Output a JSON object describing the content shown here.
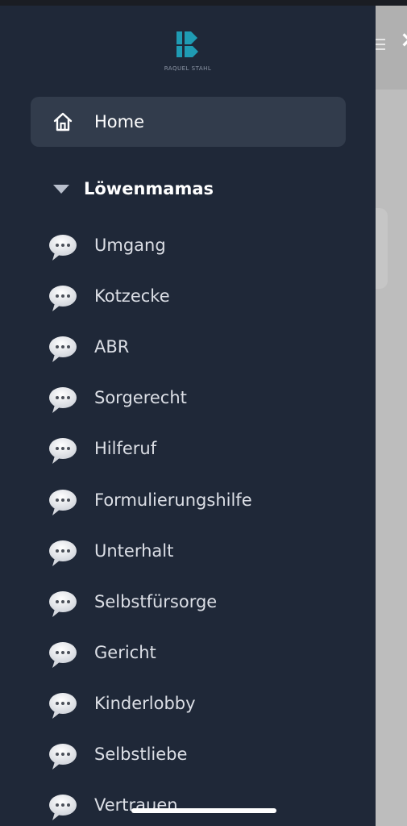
{
  "logo": {
    "text": "RAQUEL STAHL",
    "accent_color": "#1f9bb3"
  },
  "nav": {
    "home": {
      "label": "Home",
      "icon": "home-icon"
    },
    "group": {
      "label": "Löwenmamas",
      "icon": "caret-down-icon"
    },
    "channels": [
      {
        "label": "Umgang",
        "icon": "speech-bubble-icon"
      },
      {
        "label": "Kotzecke",
        "icon": "speech-bubble-icon"
      },
      {
        "label": "ABR",
        "icon": "speech-bubble-icon"
      },
      {
        "label": "Sorgerecht",
        "icon": "speech-bubble-icon"
      },
      {
        "label": "Hilferuf",
        "icon": "speech-bubble-icon"
      },
      {
        "label": "Formulierungshilfe",
        "icon": "speech-bubble-icon"
      },
      {
        "label": "Unterhalt",
        "icon": "speech-bubble-icon"
      },
      {
        "label": "Selbstfürsorge",
        "icon": "speech-bubble-icon"
      },
      {
        "label": "Gericht",
        "icon": "speech-bubble-icon"
      },
      {
        "label": "Kinderlobby",
        "icon": "speech-bubble-icon"
      },
      {
        "label": "Selbstliebe",
        "icon": "speech-bubble-icon"
      },
      {
        "label": "Vertrauen",
        "icon": "speech-bubble-icon"
      }
    ]
  },
  "background": {
    "close_glyph": "×"
  },
  "colors": {
    "drawer": "#1f2838",
    "active_item": "#323c4c",
    "text": "#dcdfe6"
  }
}
